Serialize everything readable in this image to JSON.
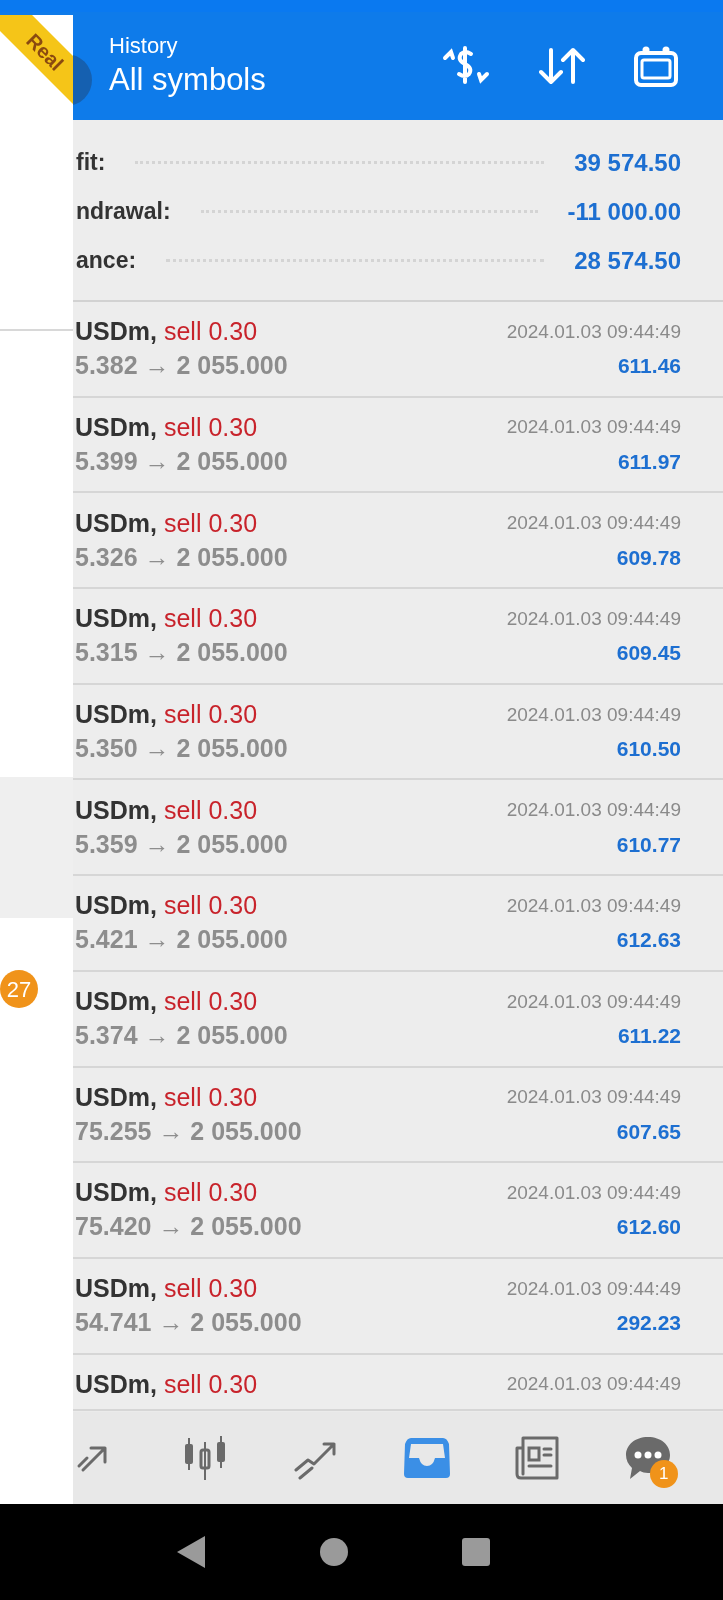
{
  "ribbon": {
    "label": "Real"
  },
  "header": {
    "subtitle": "History",
    "title": "All symbols"
  },
  "summary": [
    {
      "label": "fit:",
      "value": "39 574.50"
    },
    {
      "label": "ndrawal:",
      "value": "-11 000.00"
    },
    {
      "label": "ance:",
      "value": "28 574.50"
    }
  ],
  "deals": [
    {
      "symbol": "USDm,",
      "side": "sell 0.30",
      "prices": "5.382 → 2 055.000",
      "time": "2024.01.03 09:44:49",
      "profit": "611.46"
    },
    {
      "symbol": "USDm,",
      "side": "sell 0.30",
      "prices": "5.399 → 2 055.000",
      "time": "2024.01.03 09:44:49",
      "profit": "611.97"
    },
    {
      "symbol": "USDm,",
      "side": "sell 0.30",
      "prices": "5.326 → 2 055.000",
      "time": "2024.01.03 09:44:49",
      "profit": "609.78"
    },
    {
      "symbol": "USDm,",
      "side": "sell 0.30",
      "prices": "5.315 → 2 055.000",
      "time": "2024.01.03 09:44:49",
      "profit": "609.45"
    },
    {
      "symbol": "USDm,",
      "side": "sell 0.30",
      "prices": "5.350 → 2 055.000",
      "time": "2024.01.03 09:44:49",
      "profit": "610.50"
    },
    {
      "symbol": "USDm,",
      "side": "sell 0.30",
      "prices": "5.359 → 2 055.000",
      "time": "2024.01.03 09:44:49",
      "profit": "610.77"
    },
    {
      "symbol": "USDm,",
      "side": "sell 0.30",
      "prices": "5.421 → 2 055.000",
      "time": "2024.01.03 09:44:49",
      "profit": "612.63"
    },
    {
      "symbol": "USDm,",
      "side": "sell 0.30",
      "prices": "5.374 → 2 055.000",
      "time": "2024.01.03 09:44:49",
      "profit": "611.22"
    },
    {
      "symbol": "USDm,",
      "side": "sell 0.30",
      "prices": "75.255 → 2 055.000",
      "time": "2024.01.03 09:44:49",
      "profit": "607.65"
    },
    {
      "symbol": "USDm,",
      "side": "sell 0.30",
      "prices": "75.420 → 2 055.000",
      "time": "2024.01.03 09:44:49",
      "profit": "612.60"
    },
    {
      "symbol": "USDm,",
      "side": "sell 0.30",
      "prices": "54.741 → 2 055.000",
      "time": "2024.01.03 09:44:49",
      "profit": "292.23"
    },
    {
      "symbol": "USDm,",
      "side": "sell 0.30",
      "time": "2024.01.03 09:44:49"
    }
  ],
  "drawer": {
    "items": [
      {
        "selected": true
      }
    ],
    "badge": "27"
  },
  "bottom_nav": [
    {
      "kind": "quotes",
      "selected": false
    },
    {
      "kind": "chart",
      "selected": false
    },
    {
      "kind": "trade",
      "selected": false
    },
    {
      "kind": "history",
      "selected": true
    },
    {
      "kind": "news",
      "selected": false
    },
    {
      "kind": "chat",
      "selected": false,
      "badge": "1"
    }
  ]
}
